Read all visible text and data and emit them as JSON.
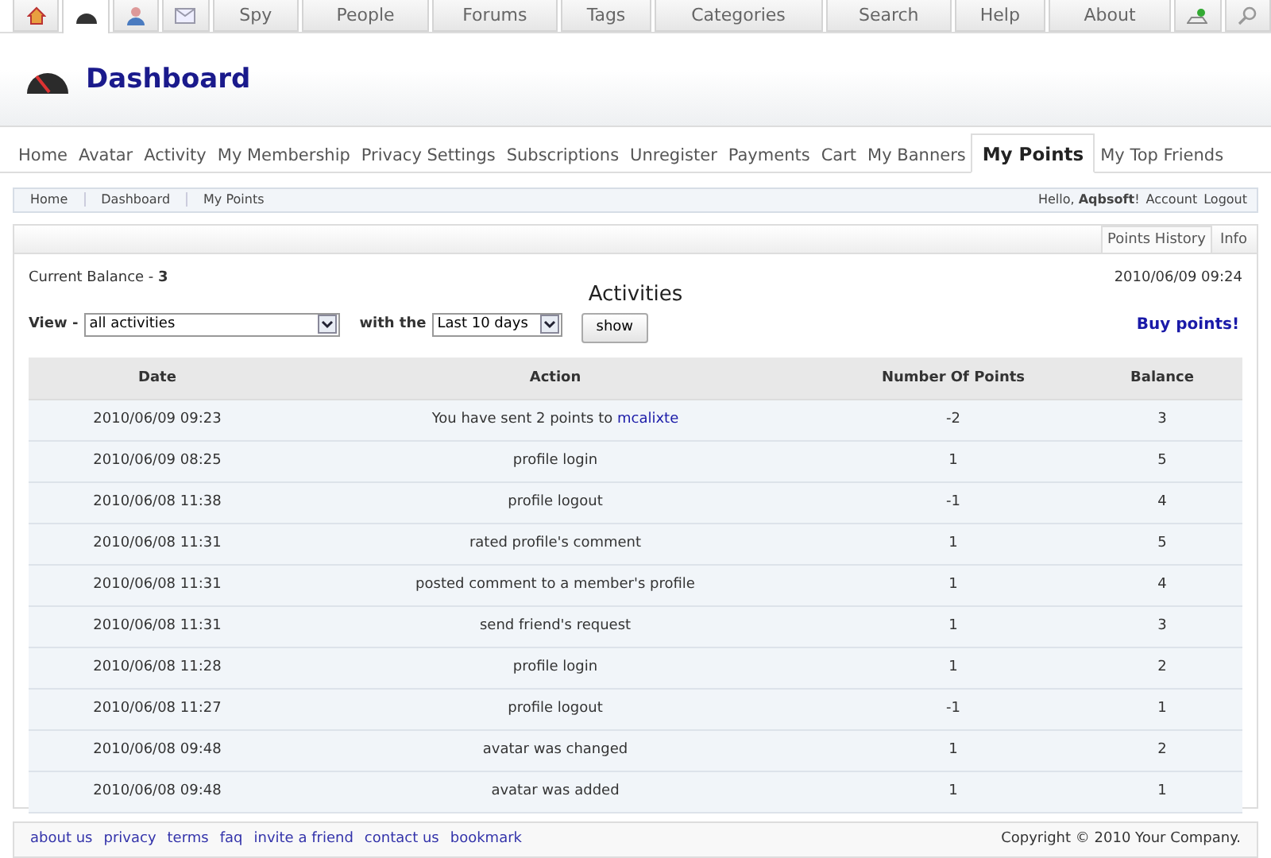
{
  "top_nav": [
    {
      "kind": "home",
      "selected": false
    },
    {
      "kind": "dashboard",
      "selected": true
    },
    {
      "kind": "profile",
      "selected": false
    },
    {
      "kind": "mail",
      "selected": false
    },
    {
      "kind": "text",
      "label": "Spy",
      "selected": false
    },
    {
      "kind": "text",
      "label": "People",
      "selected": false
    },
    {
      "kind": "text",
      "label": "Forums",
      "selected": false
    },
    {
      "kind": "text",
      "label": "Tags",
      "selected": false
    },
    {
      "kind": "text",
      "label": "Categories",
      "selected": false
    },
    {
      "kind": "text",
      "label": "Search",
      "selected": false
    },
    {
      "kind": "text",
      "label": "Help",
      "selected": false
    },
    {
      "kind": "text",
      "label": "About",
      "selected": false
    },
    {
      "kind": "upload",
      "selected": false
    },
    {
      "kind": "search",
      "selected": false
    }
  ],
  "header": {
    "title": "Dashboard"
  },
  "sub_nav": [
    {
      "label": "Home",
      "selected": false
    },
    {
      "label": "Avatar",
      "selected": false
    },
    {
      "label": "Activity",
      "selected": false
    },
    {
      "label": "My Membership",
      "selected": false
    },
    {
      "label": "Privacy Settings",
      "selected": false
    },
    {
      "label": "Subscriptions",
      "selected": false
    },
    {
      "label": "Unregister",
      "selected": false
    },
    {
      "label": "Payments",
      "selected": false
    },
    {
      "label": "Cart",
      "selected": false
    },
    {
      "label": "My Banners",
      "selected": false
    },
    {
      "label": "My Points",
      "selected": true
    },
    {
      "label": "My Top Friends",
      "selected": false
    }
  ],
  "breadcrumb": [
    "Home",
    "Dashboard",
    "My Points"
  ],
  "user_bar": {
    "greeting": "Hello, **Aqbsoft**!",
    "links": [
      "Account",
      "Logout"
    ]
  },
  "panel_tabs": [
    {
      "label": "Points History",
      "selected": true
    },
    {
      "label": "Info",
      "selected": false
    }
  ],
  "balance": "Current Balance - **3**",
  "timestamp": "2010/06/09 09:24",
  "heading": "Activities",
  "filters": {
    "view_label": "View -",
    "view_value": "all activities",
    "range_label": "with the",
    "range_value": "Last 10 days",
    "button": "show"
  },
  "buy_link": "Buy points!",
  "table": {
    "columns": [
      "Date",
      "Action",
      "Number Of Points",
      "Balance"
    ],
    "rows": [
      {
        "date": "2010/06/09 09:23",
        "action": "You have sent 2 points to",
        "link": "mcalixte",
        "points": "-2",
        "balance": "3"
      },
      {
        "date": "2010/06/09 08:25",
        "action": "profile login",
        "points": "1",
        "balance": "5"
      },
      {
        "date": "2010/06/08 11:38",
        "action": "profile logout",
        "points": "-1",
        "balance": "4"
      },
      {
        "date": "2010/06/08 11:31",
        "action": "rated profile's comment",
        "points": "1",
        "balance": "5"
      },
      {
        "date": "2010/06/08 11:31",
        "action": "posted comment to a member's profile",
        "points": "1",
        "balance": "4"
      },
      {
        "date": "2010/06/08 11:31",
        "action": "send friend's request",
        "points": "1",
        "balance": "3"
      },
      {
        "date": "2010/06/08 11:28",
        "action": "profile login",
        "points": "1",
        "balance": "2"
      },
      {
        "date": "2010/06/08 11:27",
        "action": "profile logout",
        "points": "-1",
        "balance": "1"
      },
      {
        "date": "2010/06/08 09:48",
        "action": "avatar was changed",
        "points": "1",
        "balance": "2"
      },
      {
        "date": "2010/06/08 09:48",
        "action": "avatar was added",
        "points": "1",
        "balance": "1"
      }
    ]
  },
  "footer": {
    "links": [
      "about us",
      "privacy",
      "terms",
      "faq",
      "invite a friend",
      "contact us",
      "bookmark"
    ],
    "copyright": "Copyright © 2010 Your Company."
  }
}
